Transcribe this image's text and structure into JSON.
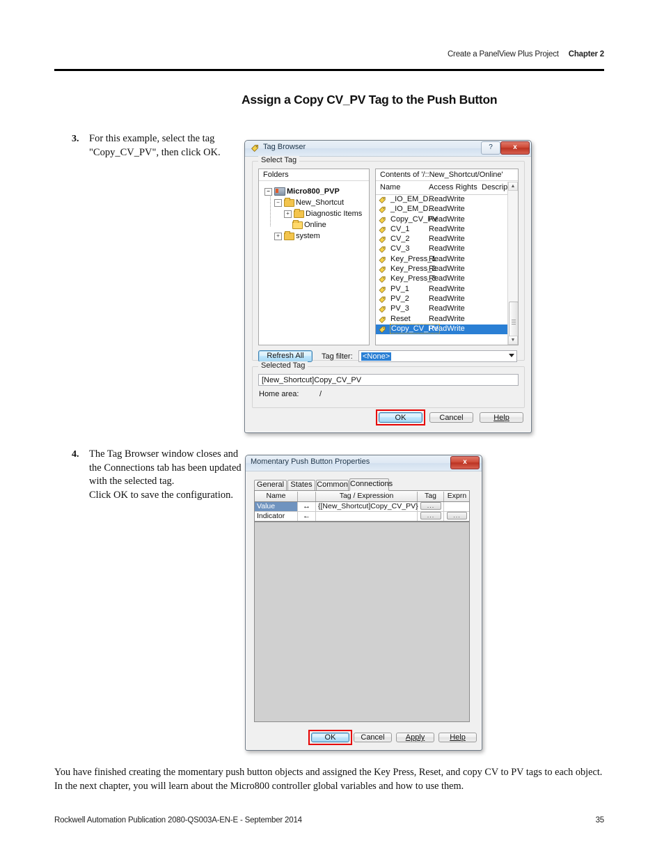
{
  "header": {
    "running_head": "Create a PanelView Plus Project",
    "chapter": "Chapter 2"
  },
  "page_title": "Assign a Copy CV_PV Tag to the Push Button",
  "steps": [
    {
      "num": "3.",
      "text": "For this example, select the tag \"Copy_CV_PV\", then click OK."
    },
    {
      "num": "4.",
      "text": "The Tag Browser window closes and the Connections tab has been updated with the selected tag.\nClick OK to save the configuration."
    }
  ],
  "closing_paragraph": "You have finished creating the momentary push button objects and assigned the Key Press, Reset, and copy CV to PV tags to each object. In the next chapter, you will learn about the Micro800 controller global variables and how to use them.",
  "footer": {
    "publication": "Rockwell Automation Publication 2080-QS003A-EN-E - September 2014",
    "page_number": "35"
  },
  "tag_browser": {
    "title": "Tag Browser",
    "help_button": "?",
    "close_button": "x",
    "group_label": "Select Tag",
    "folders_header": "Folders",
    "contents_header": "Contents of '/::New_Shortcut/Online'",
    "tree": [
      {
        "label": "Micro800_PVP",
        "indent": 0,
        "expander": "-",
        "icon": "plc-icon",
        "bold": true
      },
      {
        "label": "New_Shortcut",
        "indent": 1,
        "expander": "-",
        "icon": "folder-icon",
        "bold": false
      },
      {
        "label": "Diagnostic Items",
        "indent": 2,
        "expander": "+",
        "icon": "folder-icon",
        "bold": false
      },
      {
        "label": "Online",
        "indent": 2,
        "expander": "",
        "icon": "folder-open-icon",
        "bold": false
      },
      {
        "label": "system",
        "indent": 1,
        "expander": "+",
        "icon": "folder-icon",
        "bold": false
      }
    ],
    "list_columns": [
      "Name",
      "Access Rights",
      "Description"
    ],
    "tags": [
      {
        "name": "_IO_EM_D...",
        "access": "ReadWrite",
        "selected": false
      },
      {
        "name": "_IO_EM_D...",
        "access": "ReadWrite",
        "selected": false
      },
      {
        "name": "Copy_CV_PV",
        "access": "ReadWrite",
        "selected": false
      },
      {
        "name": "CV_1",
        "access": "ReadWrite",
        "selected": false
      },
      {
        "name": "CV_2",
        "access": "ReadWrite",
        "selected": false
      },
      {
        "name": "CV_3",
        "access": "ReadWrite",
        "selected": false
      },
      {
        "name": "Key_Press_1",
        "access": "ReadWrite",
        "selected": false
      },
      {
        "name": "Key_Press_2",
        "access": "ReadWrite",
        "selected": false
      },
      {
        "name": "Key_Press_3",
        "access": "ReadWrite",
        "selected": false
      },
      {
        "name": "PV_1",
        "access": "ReadWrite",
        "selected": false
      },
      {
        "name": "PV_2",
        "access": "ReadWrite",
        "selected": false
      },
      {
        "name": "PV_3",
        "access": "ReadWrite",
        "selected": false
      },
      {
        "name": "Reset",
        "access": "ReadWrite",
        "selected": false
      },
      {
        "name": "Copy_CV_PV",
        "access": "ReadWrite",
        "selected": true
      }
    ],
    "refresh_button": "Refresh All Folders",
    "tag_filter_label": "Tag filter:",
    "tag_filter_value": "<None>",
    "selected_tag_group": "Selected Tag",
    "selected_tag_value": "[New_Shortcut]Copy_CV_PV",
    "home_area_label": "Home area:",
    "home_area_value": "/",
    "buttons": {
      "ok": "OK",
      "cancel": "Cancel",
      "help": "Help"
    }
  },
  "push_button_props": {
    "title": "Momentary Push Button Properties",
    "close_button": "x",
    "tabs": [
      {
        "label": "General",
        "active": false
      },
      {
        "label": "States",
        "active": false
      },
      {
        "label": "Common",
        "active": false
      },
      {
        "label": "Connections",
        "active": true
      }
    ],
    "grid_columns": [
      "Name",
      "",
      "Tag / Expression",
      "Tag",
      "Exprn"
    ],
    "rows": [
      {
        "name": "Value",
        "arrow": "↔",
        "tag": "{[New_Shortcut]Copy_CV_PV}",
        "tag_btn": "...",
        "expr_btn": "",
        "selected": true
      },
      {
        "name": "Indicator",
        "arrow": "←",
        "tag": "",
        "tag_btn": "...",
        "expr_btn": "...",
        "selected": false
      }
    ],
    "buttons": {
      "ok": "OK",
      "cancel": "Cancel",
      "apply": "Apply",
      "help": "Help"
    }
  },
  "colors": {
    "highlight": "#2a7fd4",
    "red_annotation": "#e60000",
    "grid_select": "#6f93bf"
  }
}
